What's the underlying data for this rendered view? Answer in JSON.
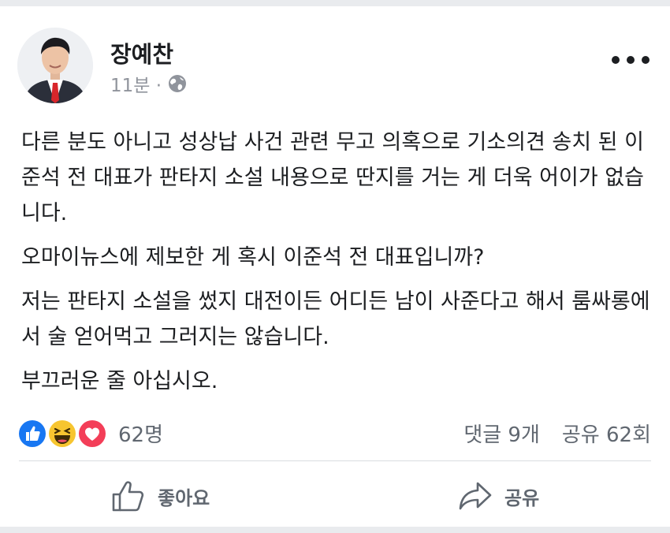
{
  "post": {
    "author": "장예찬",
    "time": "11분 ·",
    "paragraphs": [
      "다른 분도 아니고 성상납 사건 관련 무고 의혹으로 기소의견 송치 된 이준석 전 대표가 판타지 소설 내용으로 딴지를 거는 게 더욱 어이가 없습니다.",
      "오마이뉴스에 제보한 게 혹시 이준석 전 대표입니까?",
      "저는 판타지 소설을 썼지 대전이든 어디든 남이 사준다고 해서 룸싸롱에서 술 얻어먹고 그러지는 않습니다.",
      "부끄러운 줄 아십시오."
    ]
  },
  "reactions": {
    "icons": [
      "like-icon",
      "haha-icon",
      "love-icon"
    ],
    "count": "62명"
  },
  "stats": {
    "comments": "댓글 9개",
    "shares": "공유 62회"
  },
  "actions": {
    "like_label": "좋아요",
    "share_label": "공유"
  },
  "colors": {
    "like_blue": "#1877f2",
    "haha_yellow": "#f7c530",
    "love_red": "#f33e58",
    "text": "#1c1e21",
    "muted": "#90949c"
  }
}
